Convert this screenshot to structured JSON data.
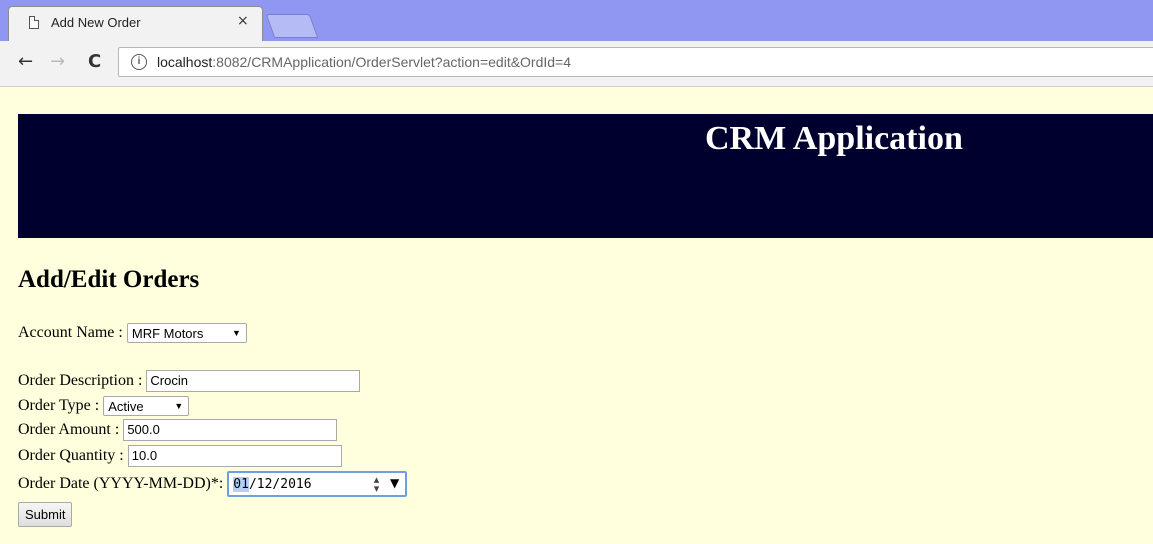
{
  "browser": {
    "tab_title": "Add New Order",
    "tab_close": "×",
    "url_host": "localhost",
    "url_rest": ":8082/CRMApplication/OrderServlet?action=edit&OrdId=4",
    "back": "←",
    "forward": "→",
    "reload": "C"
  },
  "banner": {
    "title": "CRM Application",
    "color": "#00002e"
  },
  "page": {
    "heading": "Add/Edit Orders",
    "background": "#fffedd"
  },
  "form": {
    "account_name": {
      "label": "Account Name :",
      "value": "MRF Motors"
    },
    "order_description": {
      "label": "Order Description :",
      "value": "Crocin"
    },
    "order_type": {
      "label": "Order Type :",
      "value": "Active"
    },
    "order_amount": {
      "label": "Order Amount :",
      "value": "500.0"
    },
    "order_quantity": {
      "label": "Order Quantity :",
      "value": "10.0"
    },
    "order_date": {
      "label": "Order Date (YYYY-MM-DD)*:",
      "month": "01",
      "rest": "/12/2016"
    },
    "submit_label": "Submit"
  }
}
